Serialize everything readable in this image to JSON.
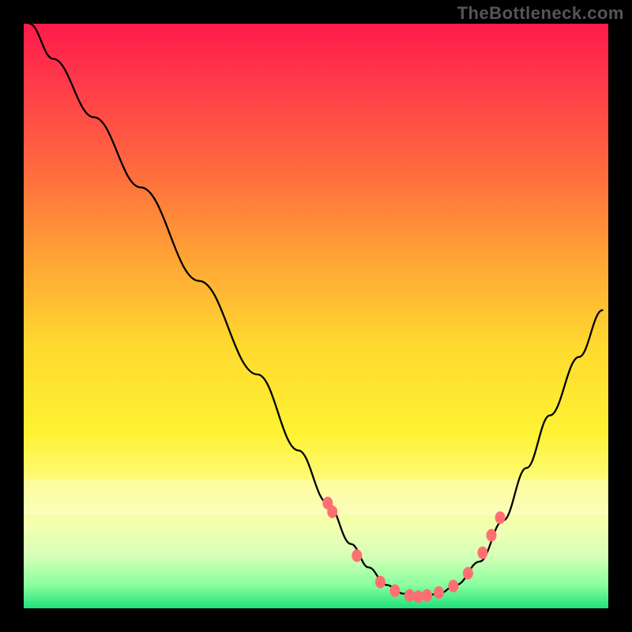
{
  "watermark": "TheBottleneck.com",
  "chart_data": {
    "type": "line",
    "title": "",
    "xlabel": "",
    "ylabel": "",
    "xlim": [
      0,
      100
    ],
    "ylim": [
      0,
      100
    ],
    "series": [
      {
        "name": "bottleneck-curve",
        "x": [
          1,
          5,
          12,
          20,
          30,
          40,
          47,
          52,
          56,
          59,
          62,
          65,
          68,
          71,
          74,
          78,
          82,
          86,
          90,
          95,
          99
        ],
        "y": [
          100,
          94,
          84,
          72,
          56,
          40,
          27,
          18,
          11,
          7,
          4,
          2.5,
          2,
          2.5,
          4,
          8,
          15,
          24,
          33,
          43,
          51
        ]
      }
    ],
    "markers": {
      "name": "highlight-dots",
      "x": [
        52,
        52.8,
        57,
        61,
        63.5,
        66,
        67.5,
        69,
        71,
        73.5,
        76,
        78.5,
        80,
        81.5
      ],
      "y": [
        18,
        16.5,
        9,
        4.5,
        3,
        2.2,
        2,
        2.2,
        2.7,
        3.8,
        6,
        9.5,
        12.5,
        15.5
      ]
    },
    "background_gradient": {
      "stops": [
        {
          "pos": 0,
          "color": "#ff1a4b"
        },
        {
          "pos": 10,
          "color": "#ff3a4a"
        },
        {
          "pos": 25,
          "color": "#ff6a3e"
        },
        {
          "pos": 40,
          "color": "#ffa336"
        },
        {
          "pos": 55,
          "color": "#ffd92f"
        },
        {
          "pos": 70,
          "color": "#fff233"
        },
        {
          "pos": 80,
          "color": "#fdfd8a"
        },
        {
          "pos": 86,
          "color": "#f3ffb0"
        },
        {
          "pos": 91,
          "color": "#d6ffb8"
        },
        {
          "pos": 96,
          "color": "#8aff9e"
        },
        {
          "pos": 100,
          "color": "#1fe07a"
        }
      ]
    },
    "pale_band_y": [
      78,
      84
    ]
  }
}
